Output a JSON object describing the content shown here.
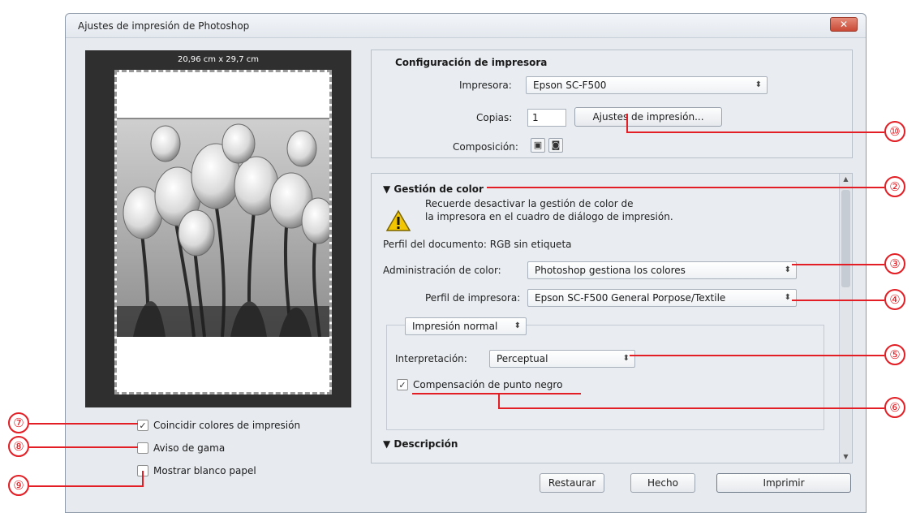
{
  "window": {
    "title": "Ajustes de impresión de Photoshop",
    "close_glyph": "✕"
  },
  "preview": {
    "paper_size": "20,96 cm x 29,7 cm"
  },
  "options": {
    "match_colors_label": "Coincidir colores de impresión",
    "match_colors_checked": true,
    "gamut_warning_label": "Aviso de gama",
    "gamut_warning_checked": false,
    "show_paper_white_label": "Mostrar blanco papel",
    "show_paper_white_checked": false
  },
  "printer_setup": {
    "section_title": "Configuración de impresora",
    "printer_label": "Impresora:",
    "printer_value": "Epson SC-F500",
    "copies_label": "Copias:",
    "copies_value": "1",
    "print_settings_button": "Ajustes de impresión...",
    "layout_label": "Composición:"
  },
  "color_management": {
    "section_title": "Gestión de color",
    "warning_line1": "Recuerde desactivar la gestión de color de",
    "warning_line2": "la impresora en el cuadro de diálogo de impresión.",
    "document_profile": "Perfil del documento: RGB sin etiqueta",
    "color_handling_label": "Administración de color:",
    "color_handling_value": "Photoshop gestiona los colores",
    "printer_profile_label": "Perfil de impresora:",
    "printer_profile_value": "Epson SC-F500 General Porpose/Textile",
    "print_mode_value": "Impresión normal",
    "rendering_label": "Interpretación:",
    "rendering_value": "Perceptual",
    "black_point_label": "Compensación de punto negro",
    "black_point_checked": true
  },
  "description": {
    "section_title": "Descripción"
  },
  "buttons": {
    "reset": "Restaurar",
    "done": "Hecho",
    "print": "Imprimir"
  },
  "annotations": [
    "⑦",
    "⑧",
    "⑨",
    "⑩",
    "②",
    "③",
    "④",
    "⑤",
    "⑥"
  ],
  "colors": {
    "annotation": "#e31e24",
    "preview_bg": "#2f2f2f",
    "dialog_bg": "#e7ebf0"
  }
}
